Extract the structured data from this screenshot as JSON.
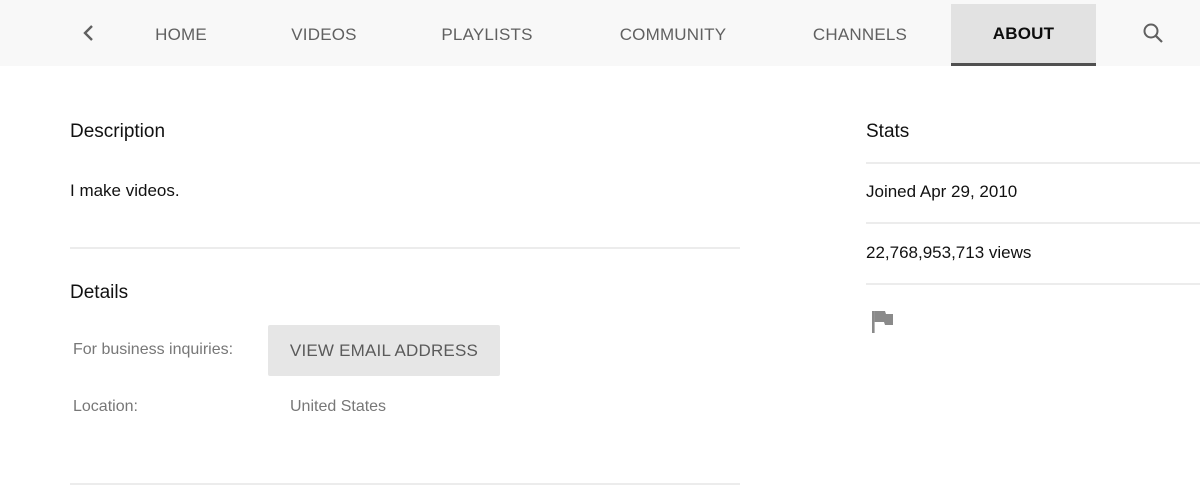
{
  "tabs": {
    "items": [
      {
        "label": "HOME",
        "active": false
      },
      {
        "label": "VIDEOS",
        "active": false
      },
      {
        "label": "PLAYLISTS",
        "active": false
      },
      {
        "label": "COMMUNITY",
        "active": false
      },
      {
        "label": "CHANNELS",
        "active": false
      },
      {
        "label": "ABOUT",
        "active": true
      }
    ],
    "back_icon": "chevron-left-icon",
    "search_icon": "search-icon"
  },
  "description": {
    "title": "Description",
    "text": "I make videos."
  },
  "details": {
    "title": "Details",
    "business_label": "For business inquiries:",
    "email_button_label": "VIEW EMAIL ADDRESS",
    "location_label": "Location:",
    "location_value": "United States"
  },
  "stats": {
    "title": "Stats",
    "joined": "Joined Apr 29, 2010",
    "views": "22,768,953,713 views",
    "report_icon": "flag-icon"
  },
  "colors": {
    "tabbar_bg": "#f8f8f8",
    "active_tab_bg": "#e2e2e2",
    "active_indicator": "#505050",
    "button_bg": "#e6e6e6"
  }
}
